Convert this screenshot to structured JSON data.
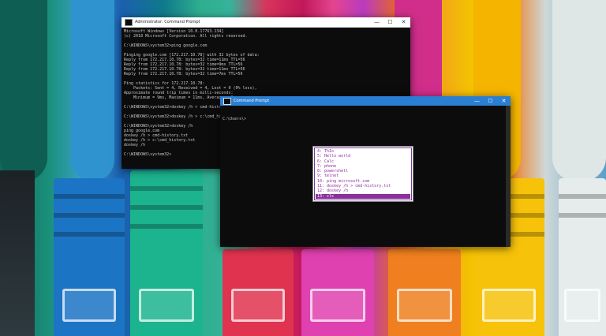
{
  "back_window": {
    "title": "Administrator: Command Prompt",
    "lines": [
      "Microsoft Windows [Version 10.0.17763.134]",
      "(c) 2018 Microsoft Corporation. All rights reserved.",
      "",
      "C:\\WINDOWS\\system32>ping google.com",
      "",
      "Pinging google.com [172.217.10.78] with 32 bytes of data:",
      "Reply from 172.217.10.78: bytes=32 time=11ms TTL=56",
      "Reply from 172.217.10.78: bytes=32 time=9ms TTL=56",
      "Reply from 172.217.10.78: bytes=32 time=11ms TTL=56",
      "Reply from 172.217.10.78: bytes=32 time=7ms TTL=56",
      "",
      "Ping statistics for 172.217.10.78:",
      "    Packets: Sent = 4, Received = 4, Lost = 0 (0% loss),",
      "Approximate round trip times in milli-seconds:",
      "    Minimum = 9ms, Maximum = 11ms, Average = 9ms",
      "",
      "C:\\WINDOWS\\system32>doskey /h > cmd-history.txt",
      "",
      "C:\\WINDOWS\\system32>doskey /h > c:\\cmd_history.txt",
      "",
      "C:\\WINDOWS\\system32>doskey /h",
      "ping google.com",
      "doskey /h > cmd-history.txt",
      "doskey /h > c:\\cmd_history.txt",
      "doskey /h",
      "",
      "C:\\WINDOWS\\system32>"
    ]
  },
  "front_window": {
    "title": "Command Prompt",
    "prompt": "C:\\Users\\>"
  },
  "history_popup": {
    "items": [
      "4: ThIo",
      "5: Hello world",
      "6: Calc",
      "7: phone",
      "8: powershell",
      "9: telnet",
      "10: ping microsoft.com",
      "11: doskey /h > cmd-history.txt",
      "12: doskey /h",
      "13: cls"
    ],
    "selected_index": 9
  },
  "controls": {
    "minimize": "—",
    "maximize": "☐",
    "close": "✕"
  },
  "colors": {
    "front_titlebar": "#2b7fd3",
    "popup_accent": "#8b2f9c"
  }
}
